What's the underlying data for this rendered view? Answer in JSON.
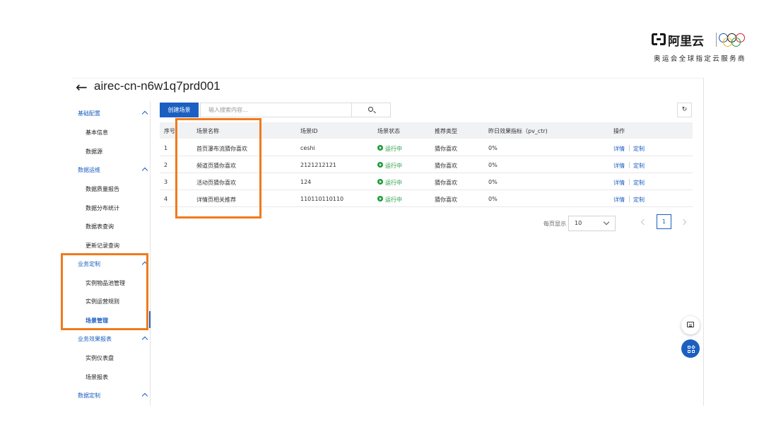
{
  "brand": {
    "logo_name": "阿里云",
    "subtitle": "奥运会全球指定云服务商",
    "ring_colors": [
      "#1a56b3",
      "#1a1a1a",
      "#d6202a",
      "#f3b41c",
      "#1f9d3e"
    ]
  },
  "header": {
    "back_icon": "arrow-left-icon",
    "title": "airec-cn-n6w1q7prd001"
  },
  "sidebar": {
    "groups": [
      {
        "label": "基础配置",
        "items": [
          "基本信息",
          "数据源"
        ]
      },
      {
        "label": "数据运维",
        "items": [
          "数据质量报告",
          "数据分布统计",
          "数据表查询",
          "更新记录查询"
        ]
      },
      {
        "label": "业务定制",
        "items": [
          "实例物品池管理",
          "实例运营规则",
          "场景管理"
        ]
      },
      {
        "label": "业务效果报表",
        "items": [
          "实例仪表盘",
          "场景报表"
        ]
      },
      {
        "label": "数据定制",
        "items": []
      }
    ],
    "active_item": "场景管理"
  },
  "toolbar": {
    "create_label": "创建场景",
    "search_placeholder": "输入搜索内容...",
    "search_icon": "search-icon",
    "refresh_icon": "refresh-icon"
  },
  "table": {
    "columns": [
      "序号",
      "场景名称",
      "场景ID",
      "场景状态",
      "推荐类型",
      "昨日效果指标（pv_ctr)",
      "操作"
    ],
    "rows": [
      {
        "index": "1",
        "name": "首页瀑布流猜你喜欢",
        "id": "ceshi",
        "status": "运行中",
        "type": "猜你喜欢",
        "metric": "0%",
        "op_detail": "详情",
        "op_custom": "定制"
      },
      {
        "index": "2",
        "name": "频道页猜你喜欢",
        "id": "2121212121",
        "status": "运行中",
        "type": "猜你喜欢",
        "metric": "0%",
        "op_detail": "详情",
        "op_custom": "定制"
      },
      {
        "index": "3",
        "name": "活动页猜你喜欢",
        "id": "124",
        "status": "运行中",
        "type": "猜你喜欢",
        "metric": "0%",
        "op_detail": "详情",
        "op_custom": "定制"
      },
      {
        "index": "4",
        "name": "详情页相关推荐",
        "id": "110110110110",
        "status": "运行中",
        "type": "猜你喜欢",
        "metric": "0%",
        "op_detail": "详情",
        "op_custom": "定制"
      }
    ]
  },
  "pagination": {
    "page_size_label": "每页显示",
    "page_size": "10",
    "current_page": "1"
  },
  "floating": {
    "chat_icon": "chat-icon",
    "apps_icon": "apps-icon"
  },
  "colors": {
    "accent": "#1b5fc1",
    "highlight": "#f07a1c",
    "running": "#1f9d3e"
  }
}
